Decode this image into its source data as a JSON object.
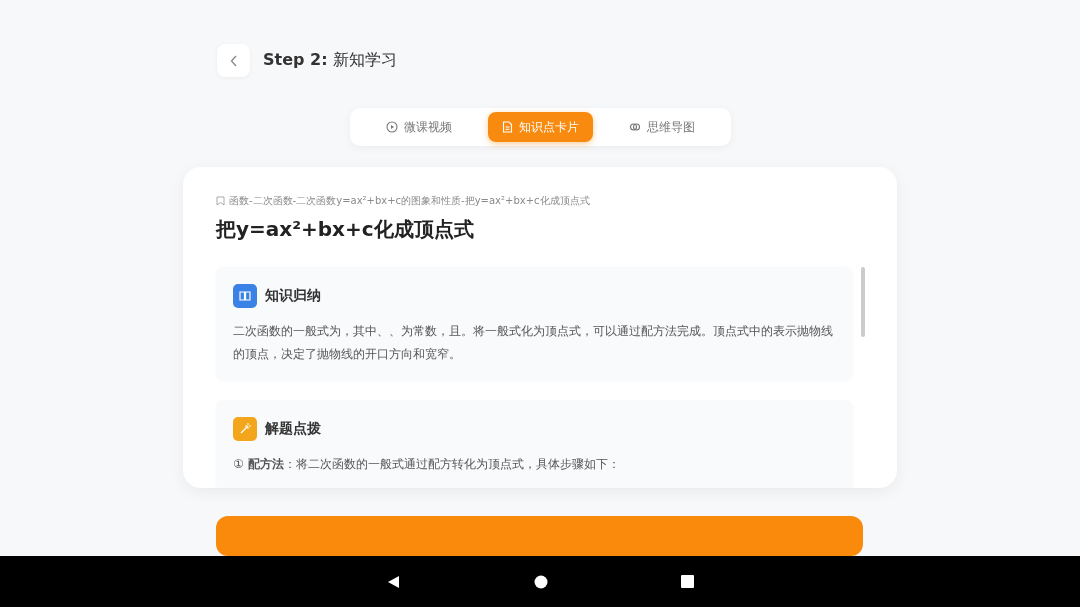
{
  "header": {
    "title": "**Step 2:** 新知学习"
  },
  "tabs": [
    {
      "label": "微课视频",
      "kind": "video",
      "selected": false
    },
    {
      "label": "知识点卡片",
      "kind": "card",
      "selected": true
    },
    {
      "label": "思维导图",
      "kind": "mindmap",
      "selected": false
    }
  ],
  "card": {
    "breadcrumb": "函数-二次函数-二次函数y=ax²+bx+c的图象和性质-把y=ax²+bx+c化成顶点式",
    "title": "把y=ax²+bx+c化成顶点式",
    "sections": [
      {
        "kind": "summary",
        "heading": "知识归纳",
        "text": "二次函数的一般式为，其中、、为常数，且。将一般式化为顶点式，可以通过配方法完成。顶点式中的表示抛物线的顶点，决定了抛物线的开口方向和宽窄。"
      },
      {
        "kind": "tip",
        "heading": "解题点拨",
        "text": "① **配方法**：将二次函数的一般式通过配方转化为顶点式，具体步骤如下："
      }
    ]
  }
}
